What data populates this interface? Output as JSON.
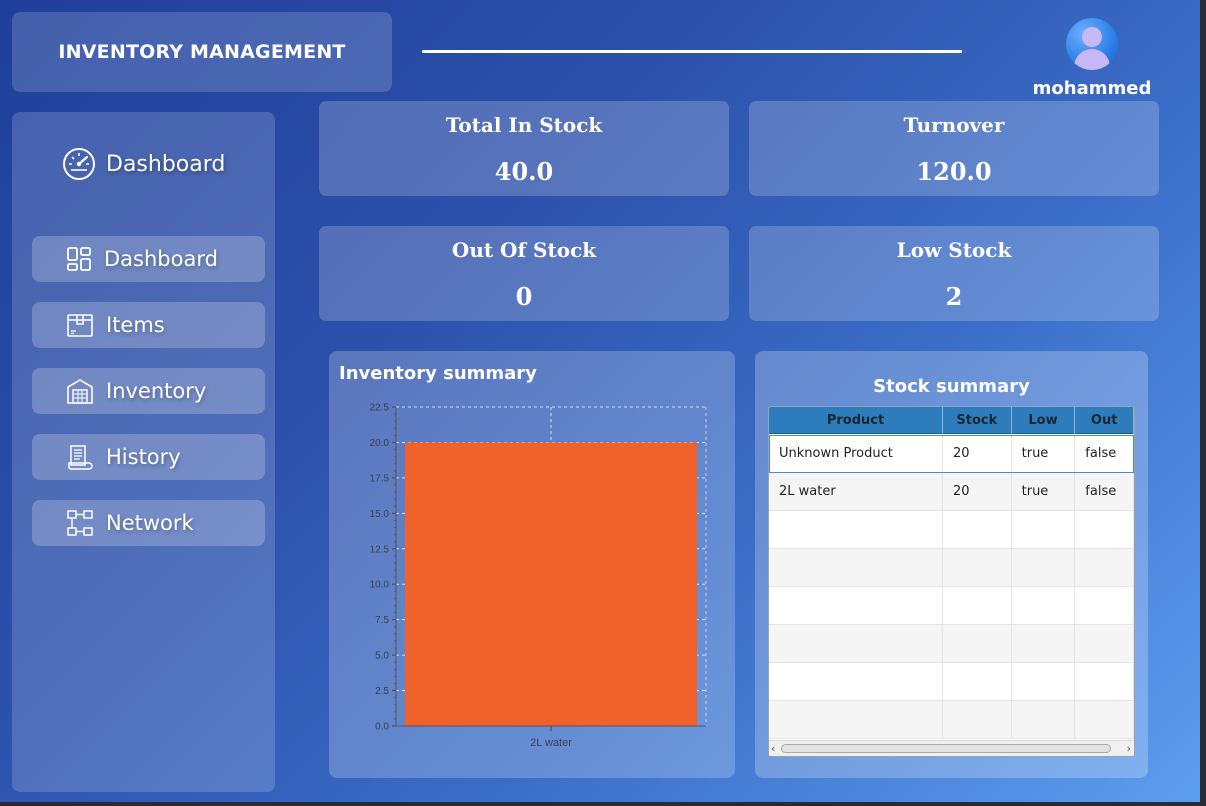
{
  "header": {
    "title": "INVENTORY MANAGEMENT",
    "username": "mohammed"
  },
  "sidebar": {
    "heading": "Dashboard",
    "heading_icon": "speedometer-icon",
    "items": [
      {
        "label": "Dashboard",
        "icon": "grid-icon"
      },
      {
        "label": "Items",
        "icon": "box-icon"
      },
      {
        "label": "Inventory",
        "icon": "warehouse-icon"
      },
      {
        "label": "History",
        "icon": "receipt-icon"
      },
      {
        "label": "Network",
        "icon": "network-icon"
      }
    ]
  },
  "cards": [
    {
      "label": "Total In Stock",
      "value": "40.0"
    },
    {
      "label": "Turnover",
      "value": "120.0"
    },
    {
      "label": "Out Of Stock",
      "value": "0"
    },
    {
      "label": "Low Stock",
      "value": "2"
    }
  ],
  "chart_data": {
    "type": "bar",
    "title": "Inventory summary",
    "categories": [
      "2L water"
    ],
    "values": [
      20
    ],
    "ylim": [
      0,
      22.5
    ],
    "yticks": [
      "0.0",
      "2.5",
      "5.0",
      "7.5",
      "10.0",
      "12.5",
      "15.0",
      "17.5",
      "20.0",
      "22.5"
    ],
    "grid": true,
    "bar_color": "#f0612b"
  },
  "table": {
    "title": "Stock summary",
    "columns": [
      "Product",
      "Stock",
      "Low",
      "Out"
    ],
    "rows": [
      [
        "Unknown Product",
        "20",
        "true",
        "false"
      ],
      [
        "2L water",
        "20",
        "true",
        "false"
      ]
    ],
    "header_color": "#2d7dbd"
  }
}
